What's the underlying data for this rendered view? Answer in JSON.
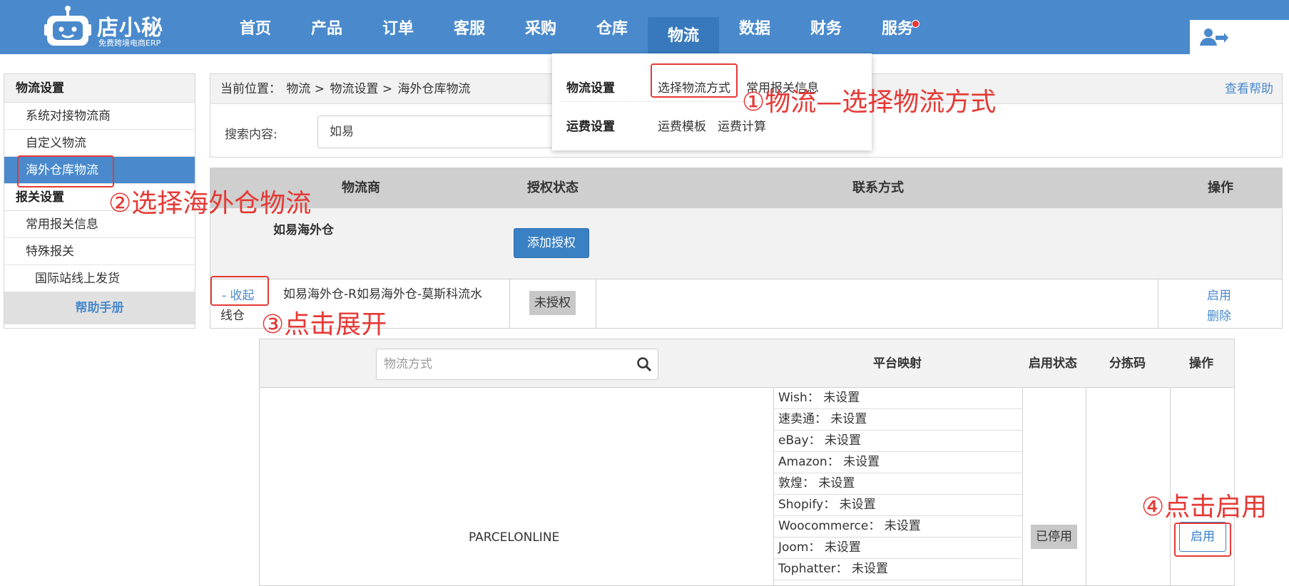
{
  "logo": {
    "name": "店小秘",
    "subtitle": "免费跨境电商ERP"
  },
  "nav": [
    {
      "label": "首页"
    },
    {
      "label": "产品"
    },
    {
      "label": "订单"
    },
    {
      "label": "客服"
    },
    {
      "label": "采购"
    },
    {
      "label": "仓库"
    },
    {
      "label": "物流",
      "active": true
    },
    {
      "label": "数据"
    },
    {
      "label": "财务"
    },
    {
      "label": "服务",
      "dot": true
    }
  ],
  "sidebar": {
    "section1": "物流设置",
    "items1": [
      "系统对接物流商",
      "自定义物流",
      "海外仓库物流"
    ],
    "section2": "报关设置",
    "items2": [
      "常用报关信息",
      "特殊报关"
    ],
    "sub_item": "国际站线上发货",
    "help": "帮助手册"
  },
  "breadcrumb": {
    "prefix": "当前位置：",
    "path": [
      "物流 >",
      "物流设置 >",
      "海外仓库物流"
    ],
    "help": "查看帮助"
  },
  "search": {
    "label": "搜索内容:",
    "value": "如易"
  },
  "dropdown": {
    "row1_title": "物流设置",
    "row1_links": [
      "选择物流方式",
      "常用报关信息"
    ],
    "row2_title": "运费设置",
    "row2_links": [
      "运费模板",
      "运费计算"
    ]
  },
  "carrier_table": {
    "headers": [
      "物流商",
      "授权状态",
      "联系方式",
      "操作"
    ],
    "group_name": "如易海外仓",
    "add_auth": "添加授权",
    "row": {
      "toggle": "- 收起",
      "name_line1": "如易海外仓-R如易海外仓-莫斯科流水",
      "name_line2": "线仓",
      "status": "未授权",
      "op_enable": "启用",
      "op_delete": "删除"
    }
  },
  "methods_table": {
    "search_placeholder": "物流方式",
    "headers": [
      "平台映射",
      "启用状态",
      "分拣码",
      "操作"
    ],
    "method_name": "PARCELONLINE",
    "mappings": [
      "Wish： 未设置",
      "速卖通： 未设置",
      "eBay： 未设置",
      "Amazon： 未设置",
      "敦煌： 未设置",
      "Shopify： 未设置",
      "Woocommerce： 未设置",
      "Joom： 未设置",
      "Tophatter： 未设置"
    ],
    "status": "已停用",
    "enable": "启用"
  },
  "annotations": {
    "a1": "①物流—选择物流方式",
    "a2": "②选择海外仓物流",
    "a3": "③点击展开",
    "a4": "④点击启用"
  },
  "colors": {
    "brand": "#4a8acc",
    "annotation": "#e53935"
  }
}
